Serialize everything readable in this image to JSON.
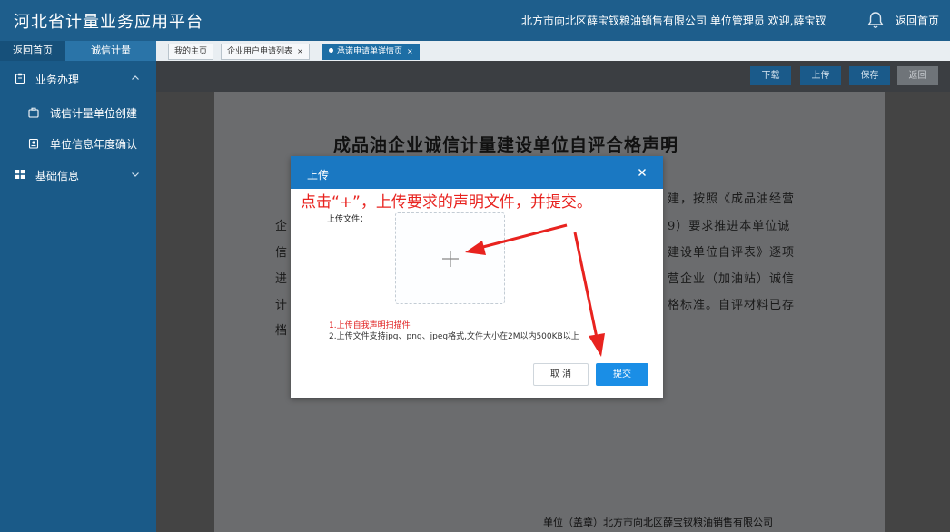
{
  "header": {
    "app_title": "河北省计量业务应用平台",
    "org_user": "北方市向北区薛宝钗粮油销售有限公司 单位管理员 欢迎,薛宝钗",
    "home_link": "返回首页"
  },
  "sidebar": {
    "tabs": [
      "返回首页",
      "诚信计量"
    ],
    "groups": [
      {
        "label": "业务办理",
        "icon": "clipboard-icon",
        "expanded": true,
        "items": [
          {
            "label": "诚信计量单位创建",
            "icon": "briefcase-icon"
          },
          {
            "label": "单位信息年度确认",
            "icon": "id-card-icon"
          }
        ]
      },
      {
        "label": "基础信息",
        "icon": "grid-icon",
        "expanded": false,
        "items": []
      }
    ]
  },
  "page_tabs": [
    {
      "label": "我的主页",
      "closable": false,
      "active": false
    },
    {
      "label": "企业用户申请列表",
      "closable": true,
      "active": false
    },
    {
      "label": "承诺申请单详情页",
      "closable": true,
      "active": true
    }
  ],
  "toolbar": {
    "download": "下载",
    "upload": "上传",
    "save": "保存",
    "back": "返回"
  },
  "document": {
    "title": "成品油企业诚信计量建设单位自评合格声明",
    "lines": [
      "建，按照《成品油经营",
      "企",
      "9）要求推进本单位诚",
      "信",
      "建设单位自评表》逐项",
      "进",
      "营企业（加油站）诚信",
      "计",
      "格标准。自评材料已存",
      "档"
    ],
    "footer": "单位（盖章）北方市向北区薛宝钗粮油销售有限公司"
  },
  "modal": {
    "title": "上传",
    "upload_label": "上传文件：",
    "hint_required": "1.上传自我声明扫描件",
    "hint_format": "2.上传文件支持jpg、png、jpeg格式,文件大小在2M以内500KB以上",
    "cancel": "取 消",
    "submit": "提交"
  },
  "annotation": {
    "text": "点击“+”，上传要求的声明文件，并提交。"
  },
  "colors": {
    "header_bg": "#1e5e8c",
    "sidebar_bg": "#1a5a88",
    "modal_header": "#1a78c2",
    "submit_button": "#1a8ee6",
    "annotation_red": "#e8231f",
    "hint_red": "#e02020"
  }
}
